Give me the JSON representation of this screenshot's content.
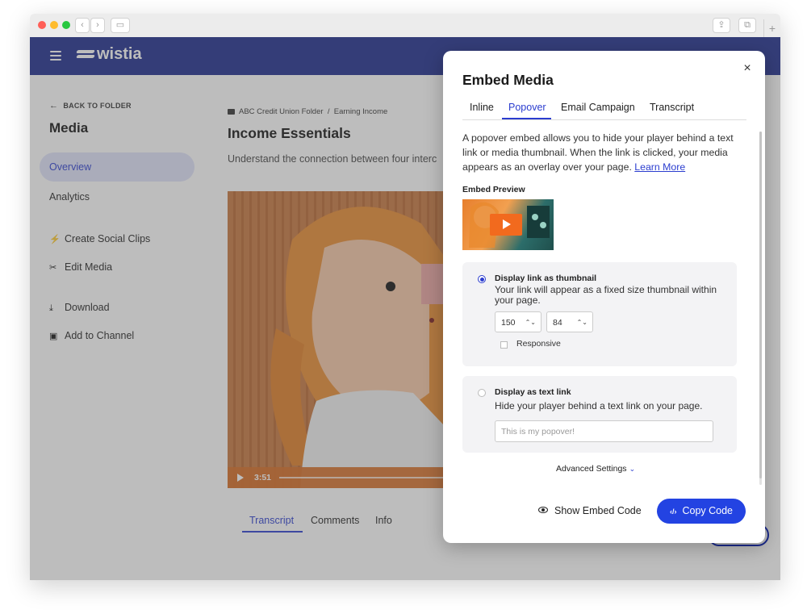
{
  "app": {
    "brand": "wistia",
    "accent_color": "#1b2a8c",
    "button_color": "#2343e2"
  },
  "sidebar": {
    "back_label": "BACK TO FOLDER",
    "title": "Media",
    "nav": [
      {
        "label": "Overview",
        "active": true
      },
      {
        "label": "Analytics",
        "active": false
      }
    ],
    "actions": [
      {
        "label": "Create Social Clips",
        "icon": "bolt-icon",
        "glyph": "⚡"
      },
      {
        "label": "Edit Media",
        "icon": "scissors-icon",
        "glyph": "✂"
      },
      {
        "label": "Download",
        "icon": "download-icon",
        "glyph": "⤓"
      },
      {
        "label": "Add to Channel",
        "icon": "channel-icon",
        "glyph": "▣"
      }
    ]
  },
  "main": {
    "breadcrumb": {
      "folder": "ABC Credit Union Folder",
      "separator": "/",
      "current": "Earning Income"
    },
    "title": "Income Essentials",
    "description": "Understand the connection between four interc",
    "video": {
      "time": "3:51"
    },
    "tabs": [
      {
        "label": "Transcript",
        "active": true
      },
      {
        "label": "Comments",
        "active": false
      },
      {
        "label": "Info",
        "active": false
      }
    ]
  },
  "modal": {
    "title": "Embed Media",
    "close_glyph": "×",
    "tabs": [
      {
        "label": "Inline",
        "active": false
      },
      {
        "label": "Popover",
        "active": true
      },
      {
        "label": "Email Campaign",
        "active": false
      },
      {
        "label": "Transcript",
        "active": false
      }
    ],
    "intro": "A popover embed allows you to hide your player behind a text link or media thumbnail. When the link is clicked, your media appears as an overlay over your page.",
    "learn_more": "Learn More",
    "preview_label": "Embed Preview",
    "option_thumbnail": {
      "title": "Display link as thumbnail",
      "description": "Your link will appear as a fixed size thumbnail within your page.",
      "selected": true,
      "width_value": "150",
      "height_value": "84",
      "responsive_label": "Responsive",
      "responsive_checked": false
    },
    "option_text": {
      "title": "Display as text link",
      "description": "Hide your player behind a text link on your page.",
      "selected": false,
      "placeholder": "This is my popover!"
    },
    "advanced": "Advanced Settings",
    "show_embed": "Show Embed Code",
    "copy_code": "Copy Code"
  }
}
